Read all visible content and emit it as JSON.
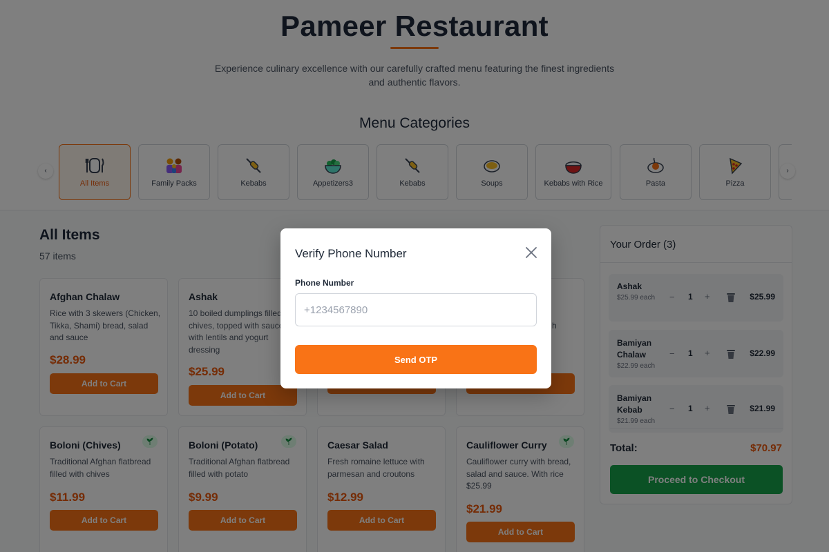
{
  "hero": {
    "title": "Pameer Restaurant",
    "subtitle": "Experience culinary excellence with our carefully crafted menu featuring the finest ingredients and authentic flavors.",
    "categories_heading": "Menu Categories"
  },
  "categories": {
    "prev_icon": "chevron-left-icon",
    "next_icon": "chevron-right-icon",
    "items": [
      {
        "label": "All Items",
        "icon": "plate-cutlery-icon",
        "active": true
      },
      {
        "label": "Family Packs",
        "icon": "family-icon"
      },
      {
        "label": "Kebabs",
        "icon": "skewer-icon"
      },
      {
        "label": "Appetizers3",
        "icon": "salad-bowl-icon"
      },
      {
        "label": "Kebabs",
        "icon": "skewer-icon"
      },
      {
        "label": "Soups",
        "icon": "soup-icon"
      },
      {
        "label": "Kebabs with Rice",
        "icon": "rice-bowl-icon"
      },
      {
        "label": "Pasta",
        "icon": "pasta-icon"
      },
      {
        "label": "Pizza",
        "icon": "pizza-icon"
      }
    ]
  },
  "items_section": {
    "title": "All Items",
    "count": "57 items",
    "add_label": "Add to Cart",
    "cards": [
      {
        "name": "Afghan Chalaw",
        "desc": "Rice with 3 skewers (Chicken, Tikka, Shami) bread, salad and sauce",
        "price": "$28.99",
        "veg": false
      },
      {
        "name": "Ashak",
        "desc": "10 boiled dumplings filled with chives, topped with sauce with lentils and yogurt dressing",
        "price": "$25.99",
        "veg": false
      },
      {
        "name": "Boloni (Chives)",
        "desc": "Traditional Afghan flatbread filled with chives",
        "price": "$11.99",
        "veg": true
      },
      {
        "name": "Boloni (Potato)",
        "desc": "Traditional Afghan flatbread filled with potato",
        "price": "$9.99",
        "veg": true
      },
      {
        "name": "Caesar Salad",
        "desc": "Fresh romaine lettuce with parmesan and croutons",
        "price": "$12.99",
        "veg": false
      },
      {
        "name": "Cauliflower Curry",
        "desc": "Cauliflower curry with bread, salad and sauce. With rice $25.99",
        "price": "$21.99",
        "veg": true
      }
    ],
    "partial_card_desc_fragment": "h"
  },
  "order": {
    "title": "Your Order (3)",
    "items": [
      {
        "name": "Ashak",
        "each": "$25.99 each",
        "qty": "1",
        "total": "$25.99"
      },
      {
        "name": "Bamiyan Chalaw",
        "each": "$22.99 each",
        "qty": "1",
        "total": "$22.99"
      },
      {
        "name": "Bamiyan Kebab",
        "each": "$21.99 each",
        "qty": "1",
        "total": "$21.99"
      }
    ],
    "minus": "−",
    "plus": "+",
    "total_label": "Total:",
    "total_value": "$70.97",
    "checkout_label": "Proceed to Checkout"
  },
  "modal": {
    "title": "Verify Phone Number",
    "phone_label": "Phone Number",
    "phone_placeholder": "+1234567890",
    "phone_value": "",
    "send_label": "Send OTP"
  },
  "colors": {
    "accent": "#f97316",
    "price": "#ea580c",
    "checkout": "#16a34a",
    "veg_badge": "#dcfce7"
  }
}
